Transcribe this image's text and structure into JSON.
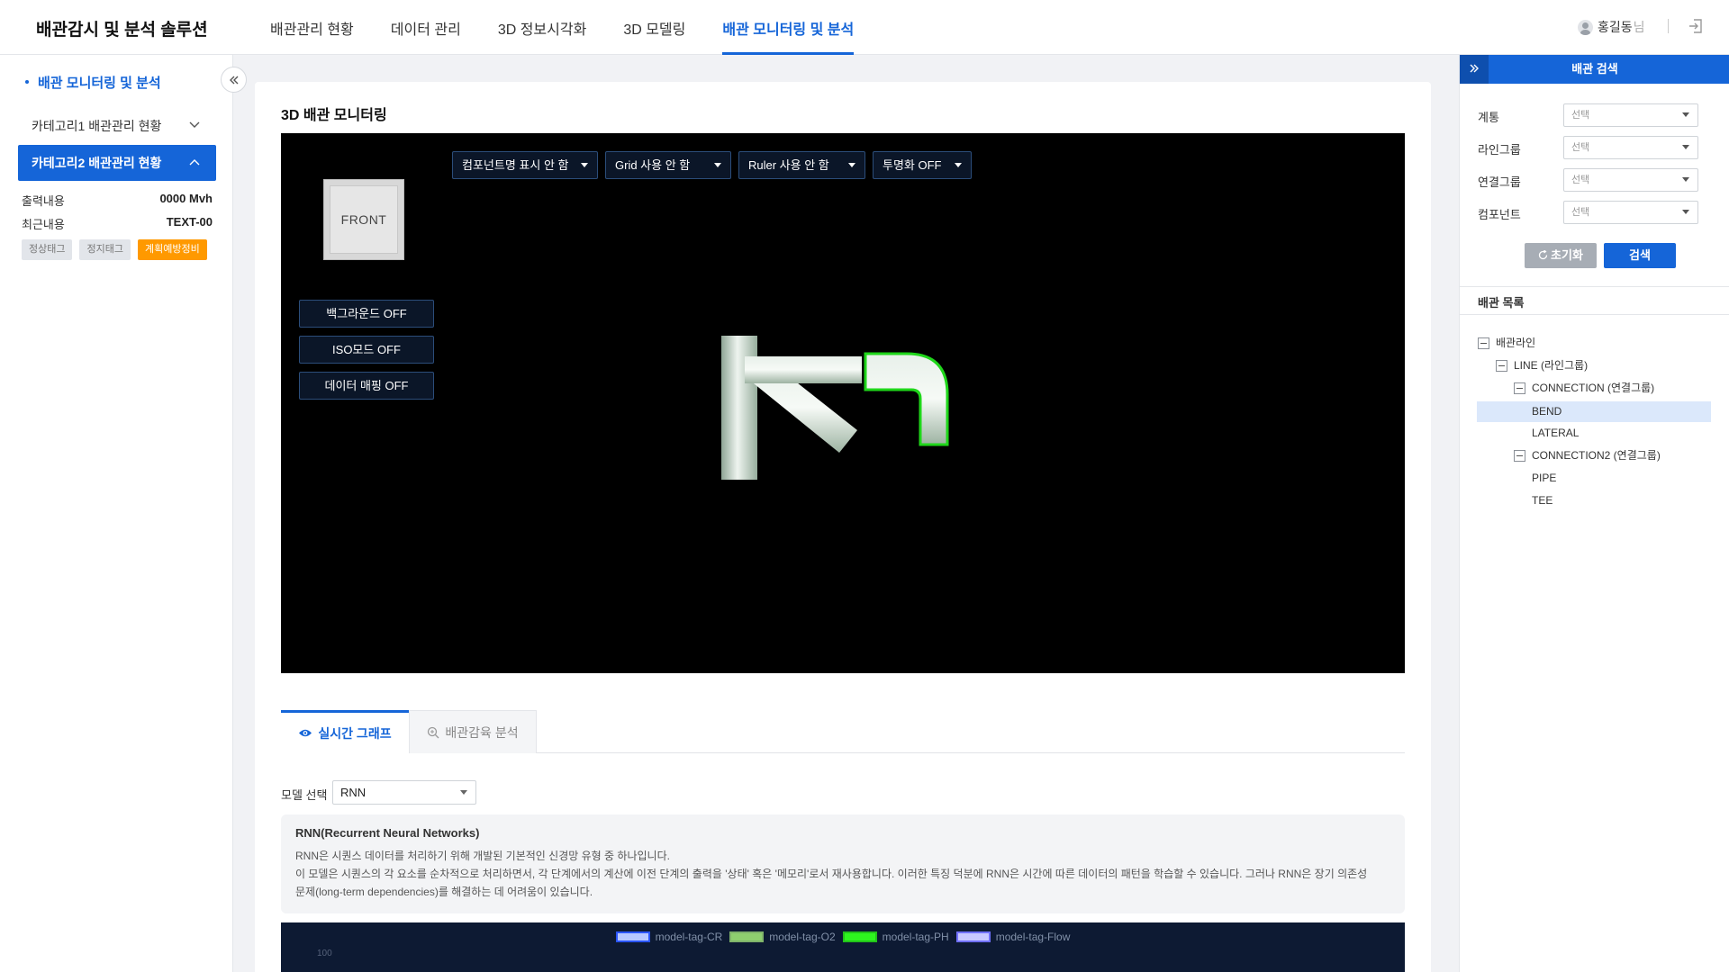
{
  "header": {
    "brand": "배관감시 및 분석 솔루션",
    "nav": [
      "배관관리 현황",
      "데이터 관리",
      "3D 정보시각화",
      "3D 모델링",
      "배관 모니터링 및 분석"
    ],
    "active_nav": "배관 모니터링 및 분석",
    "user_name": "홍길동",
    "user_suffix": "님"
  },
  "sidebar": {
    "title": "배관 모니터링 및 분석",
    "category1": "카테고리1 배관관리 현황",
    "category2": "카테고리2 배관관리 현황",
    "rows": [
      {
        "label": "출력내용",
        "value": "0000 Mvh"
      },
      {
        "label": "최근내용",
        "value": "TEXT-00"
      }
    ],
    "tags": [
      "정상태그",
      "정지태그",
      "계획예방정비"
    ]
  },
  "main": {
    "title": "3D 배관 모니터링",
    "viewer": {
      "cube_label": "FRONT",
      "buttons": [
        "백그라운드 OFF",
        "ISO모드 OFF",
        "데이터 매핑 OFF"
      ],
      "selects": [
        "컴포넌트명 표시 안 함",
        "Grid 사용 안 함",
        "Ruler 사용 안 함",
        "투명화 OFF"
      ]
    },
    "tabs": [
      "실시간 그래프",
      "배관감육 분석"
    ],
    "model_label": "모델 선택",
    "model_value": "RNN",
    "description": {
      "title": "RNN(Recurrent Neural Networks)",
      "line1": "RNN은 시퀀스 데이터를 처리하기 위해 개발된 기본적인 신경망 유형 중 하나입니다.",
      "line2": "이 모델은 시퀀스의 각 요소를 순차적으로 처리하면서, 각 단계에서의 계산에 이전 단계의 출력을 '상태' 혹은 '메모리'로서 재사용합니다. 이러한 특징 덕분에 RNN은 시간에 따른 데이터의 패턴을 학습할 수 있습니다. 그러나 RNN은 장기 의존성",
      "line3": "문제(long-term dependencies)를 해결하는 데 어려움이 있습니다."
    },
    "chart": {
      "legend": [
        {
          "name": "model-tag-CR",
          "color": "#2a55ff",
          "fill": "#b7c8ff"
        },
        {
          "name": "model-tag-O2",
          "color": "#7fb36a",
          "fill": "#8ecf6f"
        },
        {
          "name": "model-tag-PH",
          "color": "#22c41a",
          "fill": "#2ef51f"
        },
        {
          "name": "model-tag-Flow",
          "color": "#7070ff",
          "fill": "#c8c8ff"
        }
      ],
      "ytick_top": "100"
    }
  },
  "right_panel": {
    "title": "배관 검색",
    "filters": [
      {
        "label": "계통",
        "value": "선택"
      },
      {
        "label": "라인그룹",
        "value": "선택"
      },
      {
        "label": "연결그룹",
        "value": "선택"
      },
      {
        "label": "컴포넌트",
        "value": "선택"
      }
    ],
    "reset_label": "초기화",
    "search_label": "검색",
    "list_title": "배관 목록",
    "tree": {
      "root": "배관라인",
      "line": "LINE (라인그룹)",
      "conn1": "CONNECTION (연결그룹)",
      "conn1_items": [
        "BEND",
        "LATERAL"
      ],
      "conn2": "CONNECTION2 (연결그룹)",
      "conn2_items": [
        "PIPE",
        "TEE"
      ],
      "selected": "BEND"
    }
  }
}
